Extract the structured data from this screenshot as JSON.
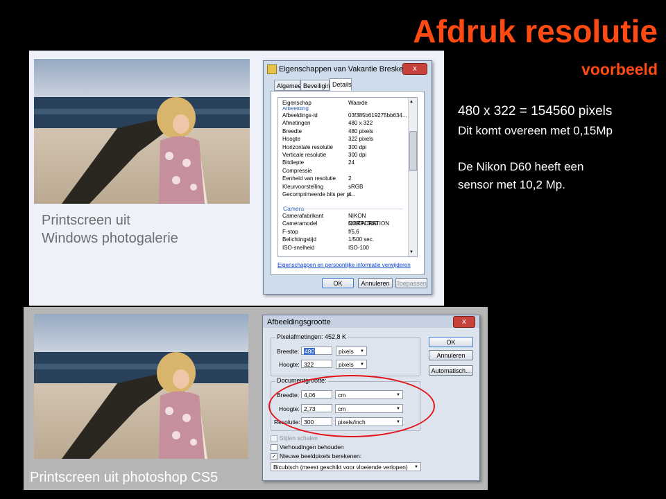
{
  "slide": {
    "title": "Afdruk resolutie",
    "subtitle": "voorbeeld",
    "info": {
      "line1": "480 x 322 = 154560 pixels",
      "line2": "Dit komt overeen met 0,15Mp",
      "line3": "De Nikon D60 heeft een",
      "line4": "sensor met 10,2 Mp."
    }
  },
  "gallery_panel": {
    "caption_line1": "Printscreen uit",
    "caption_line2": "Windows photogalerie",
    "dialog": {
      "title": "Eigenschappen van Vakantie Breskens (50)",
      "close_label": "x",
      "tabs": [
        "Algemeen",
        "Beveiliging",
        "Details"
      ],
      "col_header_property": "Eigenschap",
      "col_header_value": "Waarde",
      "section_image": "Afbeelding",
      "rows": [
        {
          "k": "Afbeeldings-id",
          "v": "03f385b619275bb634..."
        },
        {
          "k": "Afmetingen",
          "v": "480 x 322"
        },
        {
          "k": "Breedte",
          "v": "480 pixels"
        },
        {
          "k": "Hoogte",
          "v": "322 pixels"
        },
        {
          "k": "Horizontale resolutie",
          "v": "300 dpi"
        },
        {
          "k": "Verticale resolutie",
          "v": "300 dpi"
        },
        {
          "k": "Bitdiepte",
          "v": "24"
        },
        {
          "k": "Compressie",
          "v": ""
        },
        {
          "k": "Eenheid van resolutie",
          "v": "2"
        },
        {
          "k": "Kleurvoorstelling",
          "v": "sRGB"
        },
        {
          "k": "Gecomprimeerde bits per pi...",
          "v": "4"
        }
      ],
      "section_camera": "Camera",
      "camera_rows": [
        {
          "k": "Camerafabrikant",
          "v": "NIKON CORPORATION"
        },
        {
          "k": "Cameramodel",
          "v": "NIKON D60"
        },
        {
          "k": "F-stop",
          "v": "f/5,6"
        },
        {
          "k": "Belichtingstijd",
          "v": "1/500 sec."
        },
        {
          "k": "ISO-snelheid",
          "v": "ISO-100"
        }
      ],
      "link": "Eigenschappen en persoonlijke informatie verwijderen",
      "ok": "OK",
      "cancel": "Annuleren",
      "apply": "Toepassen"
    }
  },
  "photoshop_panel": {
    "caption": "Printscreen uit photoshop CS5",
    "dialog": {
      "title": "Afbeeldingsgrootte",
      "close_label": "x",
      "pixel_group": "Pixelafmetingen:  452,8 K",
      "width_label": "Breedte:",
      "width_value": "480",
      "width_unit": "pixels",
      "height_label": "Hoogte:",
      "height_value": "322",
      "height_unit": "pixels",
      "doc_group": "Documentgrootte:",
      "doc_width_label": "Breedte:",
      "doc_width_value": "4,06",
      "doc_width_unit": "cm",
      "doc_height_label": "Hoogte:",
      "doc_height_value": "2,73",
      "doc_height_unit": "cm",
      "res_label": "Resolutie:",
      "res_value": "300",
      "res_unit": "pixels/inch",
      "chk_scale": "Stijlen schalen",
      "chk_constrain": "Verhoudingen behouden",
      "chk_resample": "Nieuwe beeldpixels berekenen:",
      "resample_method": "Bicubisch (meest geschikt voor vloeiende verlopen)",
      "ok": "OK",
      "cancel": "Annuleren",
      "auto": "Automatisch..."
    }
  },
  "colors": {
    "title": "#ff4a12",
    "highlight_circle": "#e3141c",
    "background": "#000000"
  }
}
